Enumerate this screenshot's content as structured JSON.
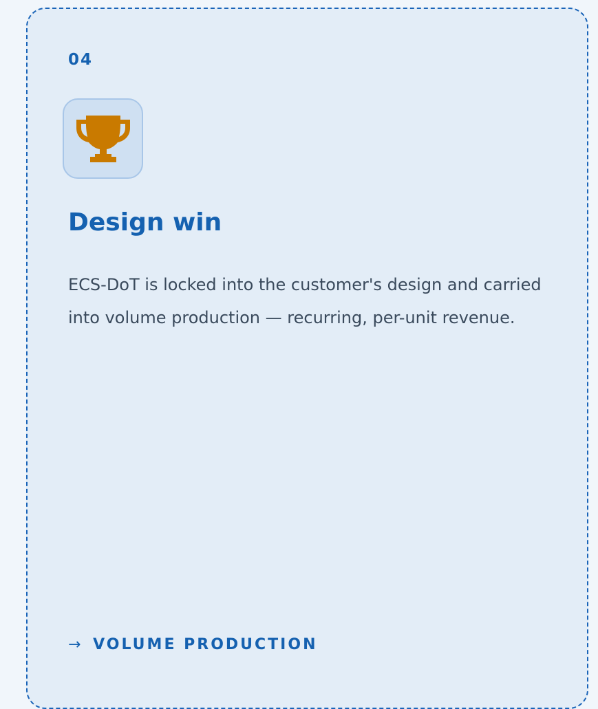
{
  "card": {
    "step_number": "04",
    "icon": "trophy-icon",
    "title": "Design win",
    "description": "ECS-DoT is locked into the customer's design and carried into volume production — recurring, per-unit revenue.",
    "next_arrow": "→",
    "next_label": "VOLUME PRODUCTION"
  },
  "colors": {
    "accent": "#1561b0",
    "icon": "#c97a00",
    "card_background": "#e3edf7",
    "page_background": "#f1f6fb"
  }
}
